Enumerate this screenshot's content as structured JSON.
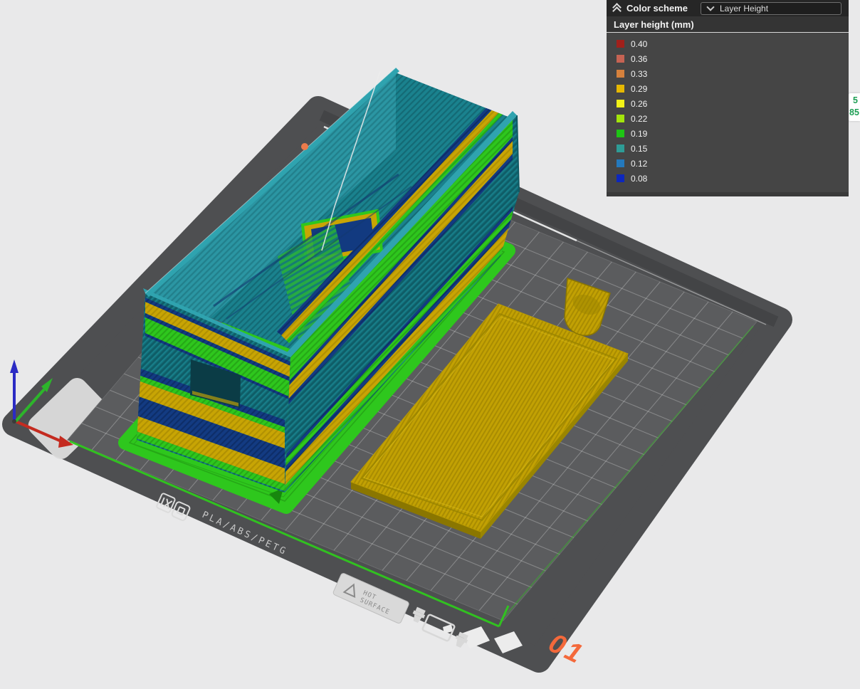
{
  "legend_panel": {
    "title": "Color scheme",
    "collapse_icon": "chevrons-up-icon",
    "dropdown": {
      "value": "Layer Height",
      "icon": "chevron-down-icon"
    },
    "section_header": "Layer height (mm)",
    "items": [
      {
        "label": "0.40",
        "color": "#A1201B"
      },
      {
        "label": "0.36",
        "color": "#C66353"
      },
      {
        "label": "0.33",
        "color": "#D6813C"
      },
      {
        "label": "0.29",
        "color": "#E6B800"
      },
      {
        "label": "0.26",
        "color": "#F2F216"
      },
      {
        "label": "0.22",
        "color": "#A3E50B"
      },
      {
        "label": "0.19",
        "color": "#1EC514"
      },
      {
        "label": "0.15",
        "color": "#2E9C96"
      },
      {
        "label": "0.12",
        "color": "#2479BD"
      },
      {
        "label": "0.08",
        "color": "#0D27BE"
      }
    ]
  },
  "layer_slider_tooltip": {
    "line1": "5",
    "line2": "85",
    "text_color": "#1D9E53"
  },
  "build_plate": {
    "material_text": "PLA/ABS/PETG",
    "warning_label": {
      "line1": "HOT",
      "line2": "SURFACE"
    },
    "plate_number": "01"
  },
  "axes": {
    "x_color": "#C42B20",
    "y_color": "#2DB52B",
    "z_color": "#2B2BC4"
  },
  "scene_colors": {
    "background": "#E9E9EA",
    "plate": "#4E4F51",
    "grid_area": "#5B5C5E",
    "printable_boundary": "#2FC71E",
    "model_teal": "#136F7A",
    "model_gold": "#C8A504",
    "model_navy": "#133B82",
    "model_green": "#2EC71D",
    "lid_gold": "#C2A103",
    "plate_number_orange": "#F4693B"
  }
}
